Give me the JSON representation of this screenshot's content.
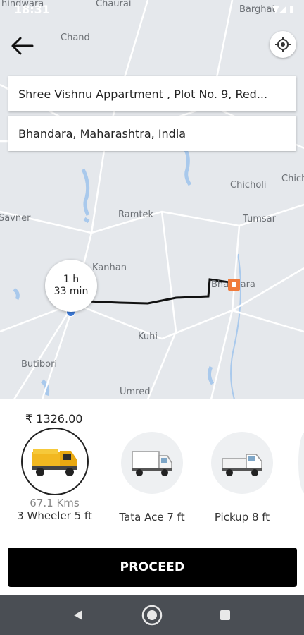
{
  "status_bar": {
    "time": "18:31"
  },
  "map": {
    "places": [
      "Chand",
      "Chaurai",
      "Barghat",
      "Chicholi",
      "Chich",
      "Savner",
      "Ramtek",
      "Tumsar",
      "Kanhan",
      "Bhandara",
      "Kuhi",
      "Butibori",
      "Umred",
      "hindwara"
    ]
  },
  "route": {
    "pickup": "Shree Vishnu Appartment , Plot No. 9, Red...",
    "drop": "Bhandara, Maharashtra, India",
    "eta_hours": "1 h",
    "eta_minutes": "33 min"
  },
  "booking": {
    "price": "₹ 1326.00",
    "distance": "67.1 Kms",
    "vehicles": [
      {
        "label": "3 Wheeler 5 ft",
        "selected": true
      },
      {
        "label": "Tata Ace 7 ft",
        "selected": false
      },
      {
        "label": "Pickup 8 ft",
        "selected": false
      }
    ],
    "proceed_label": "PROCEED"
  },
  "colors": {
    "accent": "#000000",
    "route_line": "#111111",
    "marker": "#f07a3a",
    "navbar": "#4a4e54"
  }
}
